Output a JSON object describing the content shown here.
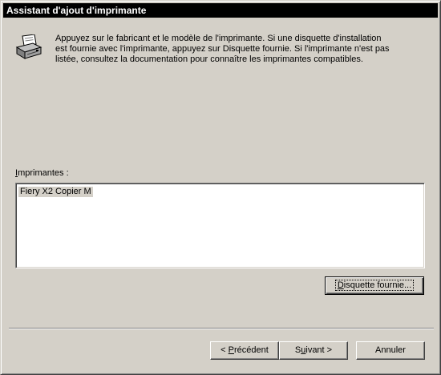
{
  "window": {
    "title": "Assistant d'ajout d'imprimante"
  },
  "intro": {
    "icon": "printer-icon",
    "text": "Appuyez sur le fabricant et le modèle de l'imprimante. Si une disquette d'installation\nest fournie avec l'imprimante, appuyez sur Disquette fournie. Si l'imprimante n'est pas\nlistée, consultez la documentation pour connaître les imprimantes compatibles."
  },
  "printers": {
    "label_first": "I",
    "label_rest": "mprimantes :",
    "items": [
      "Fiery X2 Copier M"
    ]
  },
  "buttons": {
    "have_disk_first": "D",
    "have_disk_rest": "isquette fournie...",
    "back_pre": "< ",
    "back_mnemonic": "P",
    "back_rest": "récédent",
    "next_pre": "S",
    "next_mnemonic": "u",
    "next_rest": "ivant >",
    "cancel": "Annuler"
  },
  "colors": {
    "face": "#d4d0c8",
    "titlebar": "#000000",
    "selection": "#d4d0c8"
  }
}
